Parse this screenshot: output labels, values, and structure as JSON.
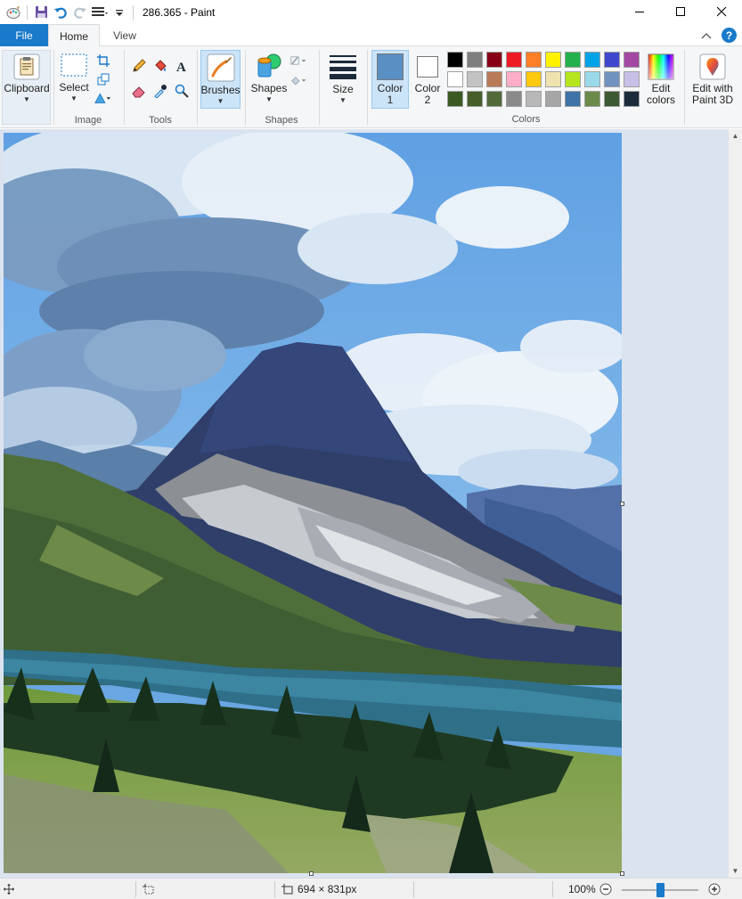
{
  "window": {
    "title": "286.365 - Paint"
  },
  "tabs": {
    "file": "File",
    "home": "Home",
    "view": "View"
  },
  "ribbon": {
    "clipboard": {
      "label": "Clipboard"
    },
    "image": {
      "select_label": "Select",
      "group_label": "Image"
    },
    "tools": {
      "group_label": "Tools"
    },
    "brushes": {
      "label": "Brushes"
    },
    "shapes": {
      "label": "Shapes",
      "group_label": "Shapes"
    },
    "size": {
      "label": "Size"
    },
    "colors": {
      "color1_line1": "Color",
      "color1_line2": "1",
      "color2_line1": "Color",
      "color2_line2": "2",
      "edit_line1": "Edit",
      "edit_line2": "colors",
      "group_label": "Colors",
      "color1_value": "#5a8fc4",
      "color2_value": "#ffffff",
      "palette": [
        "#000000",
        "#7f7f7f",
        "#880015",
        "#ed1c24",
        "#ff7f27",
        "#fff200",
        "#22b14c",
        "#00a2e8",
        "#3f48cc",
        "#a349a4",
        "#ffffff",
        "#c3c3c3",
        "#b97a57",
        "#ffaec9",
        "#ffc90e",
        "#efe4b0",
        "#b5e61d",
        "#99d9ea",
        "#7092be",
        "#c8bfe7",
        "#3b5a22",
        "#455e2a",
        "#52693a",
        "#8a8a8a",
        "#b8b8b8",
        "#a6a6a6",
        "#3f72a6",
        "#6b8a4a",
        "#3b5a33",
        "#1c2b3a"
      ]
    },
    "paint3d": {
      "line1": "Edit with",
      "line2": "Paint 3D"
    }
  },
  "status": {
    "dimensions": "694 × 831px",
    "zoom": "100%",
    "zoom_level": 0.5
  }
}
